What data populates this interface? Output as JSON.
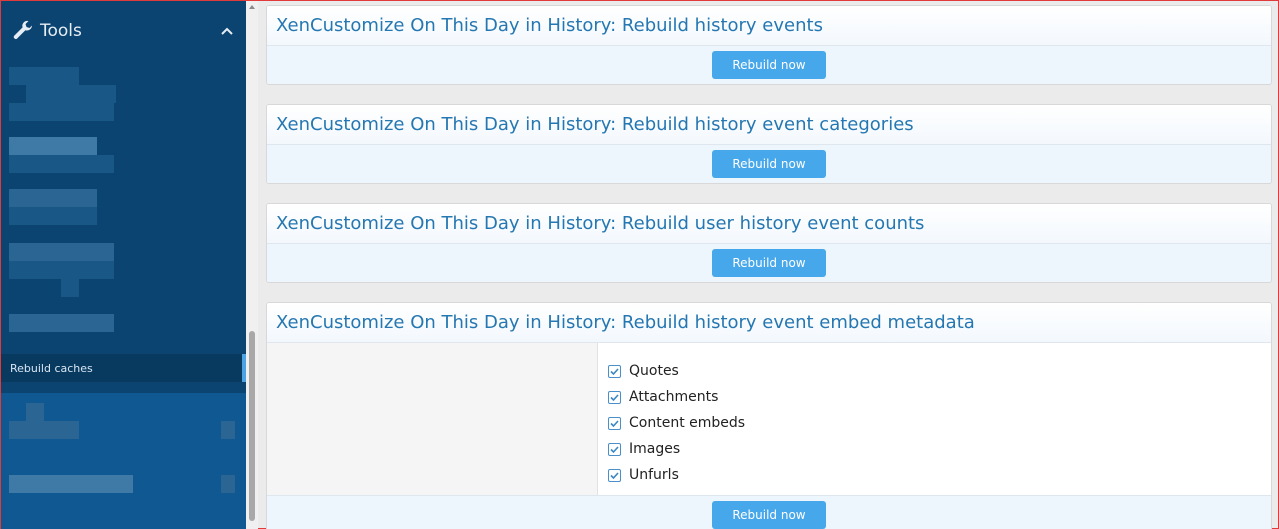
{
  "sidebar": {
    "section_title": "Tools",
    "icon": "wrench-icon",
    "active_item": "Rebuild caches"
  },
  "blocks": [
    {
      "title": "XenCustomize On This Day in History: Rebuild history events",
      "button": "Rebuild now"
    },
    {
      "title": "XenCustomize On This Day in History: Rebuild history event categories",
      "button": "Rebuild now"
    },
    {
      "title": "XenCustomize On This Day in History: Rebuild user history event counts",
      "button": "Rebuild now"
    },
    {
      "title": "XenCustomize On This Day in History: Rebuild history event embed metadata",
      "button": "Rebuild now",
      "options": [
        {
          "label": "Quotes",
          "checked": true
        },
        {
          "label": "Attachments",
          "checked": true
        },
        {
          "label": "Content embeds",
          "checked": true
        },
        {
          "label": "Images",
          "checked": true
        },
        {
          "label": "Unfurls",
          "checked": true
        }
      ]
    }
  ],
  "colors": {
    "sidebar_bg": "#0b4470",
    "accent": "#47a7eb",
    "title_text": "#2577b1"
  }
}
